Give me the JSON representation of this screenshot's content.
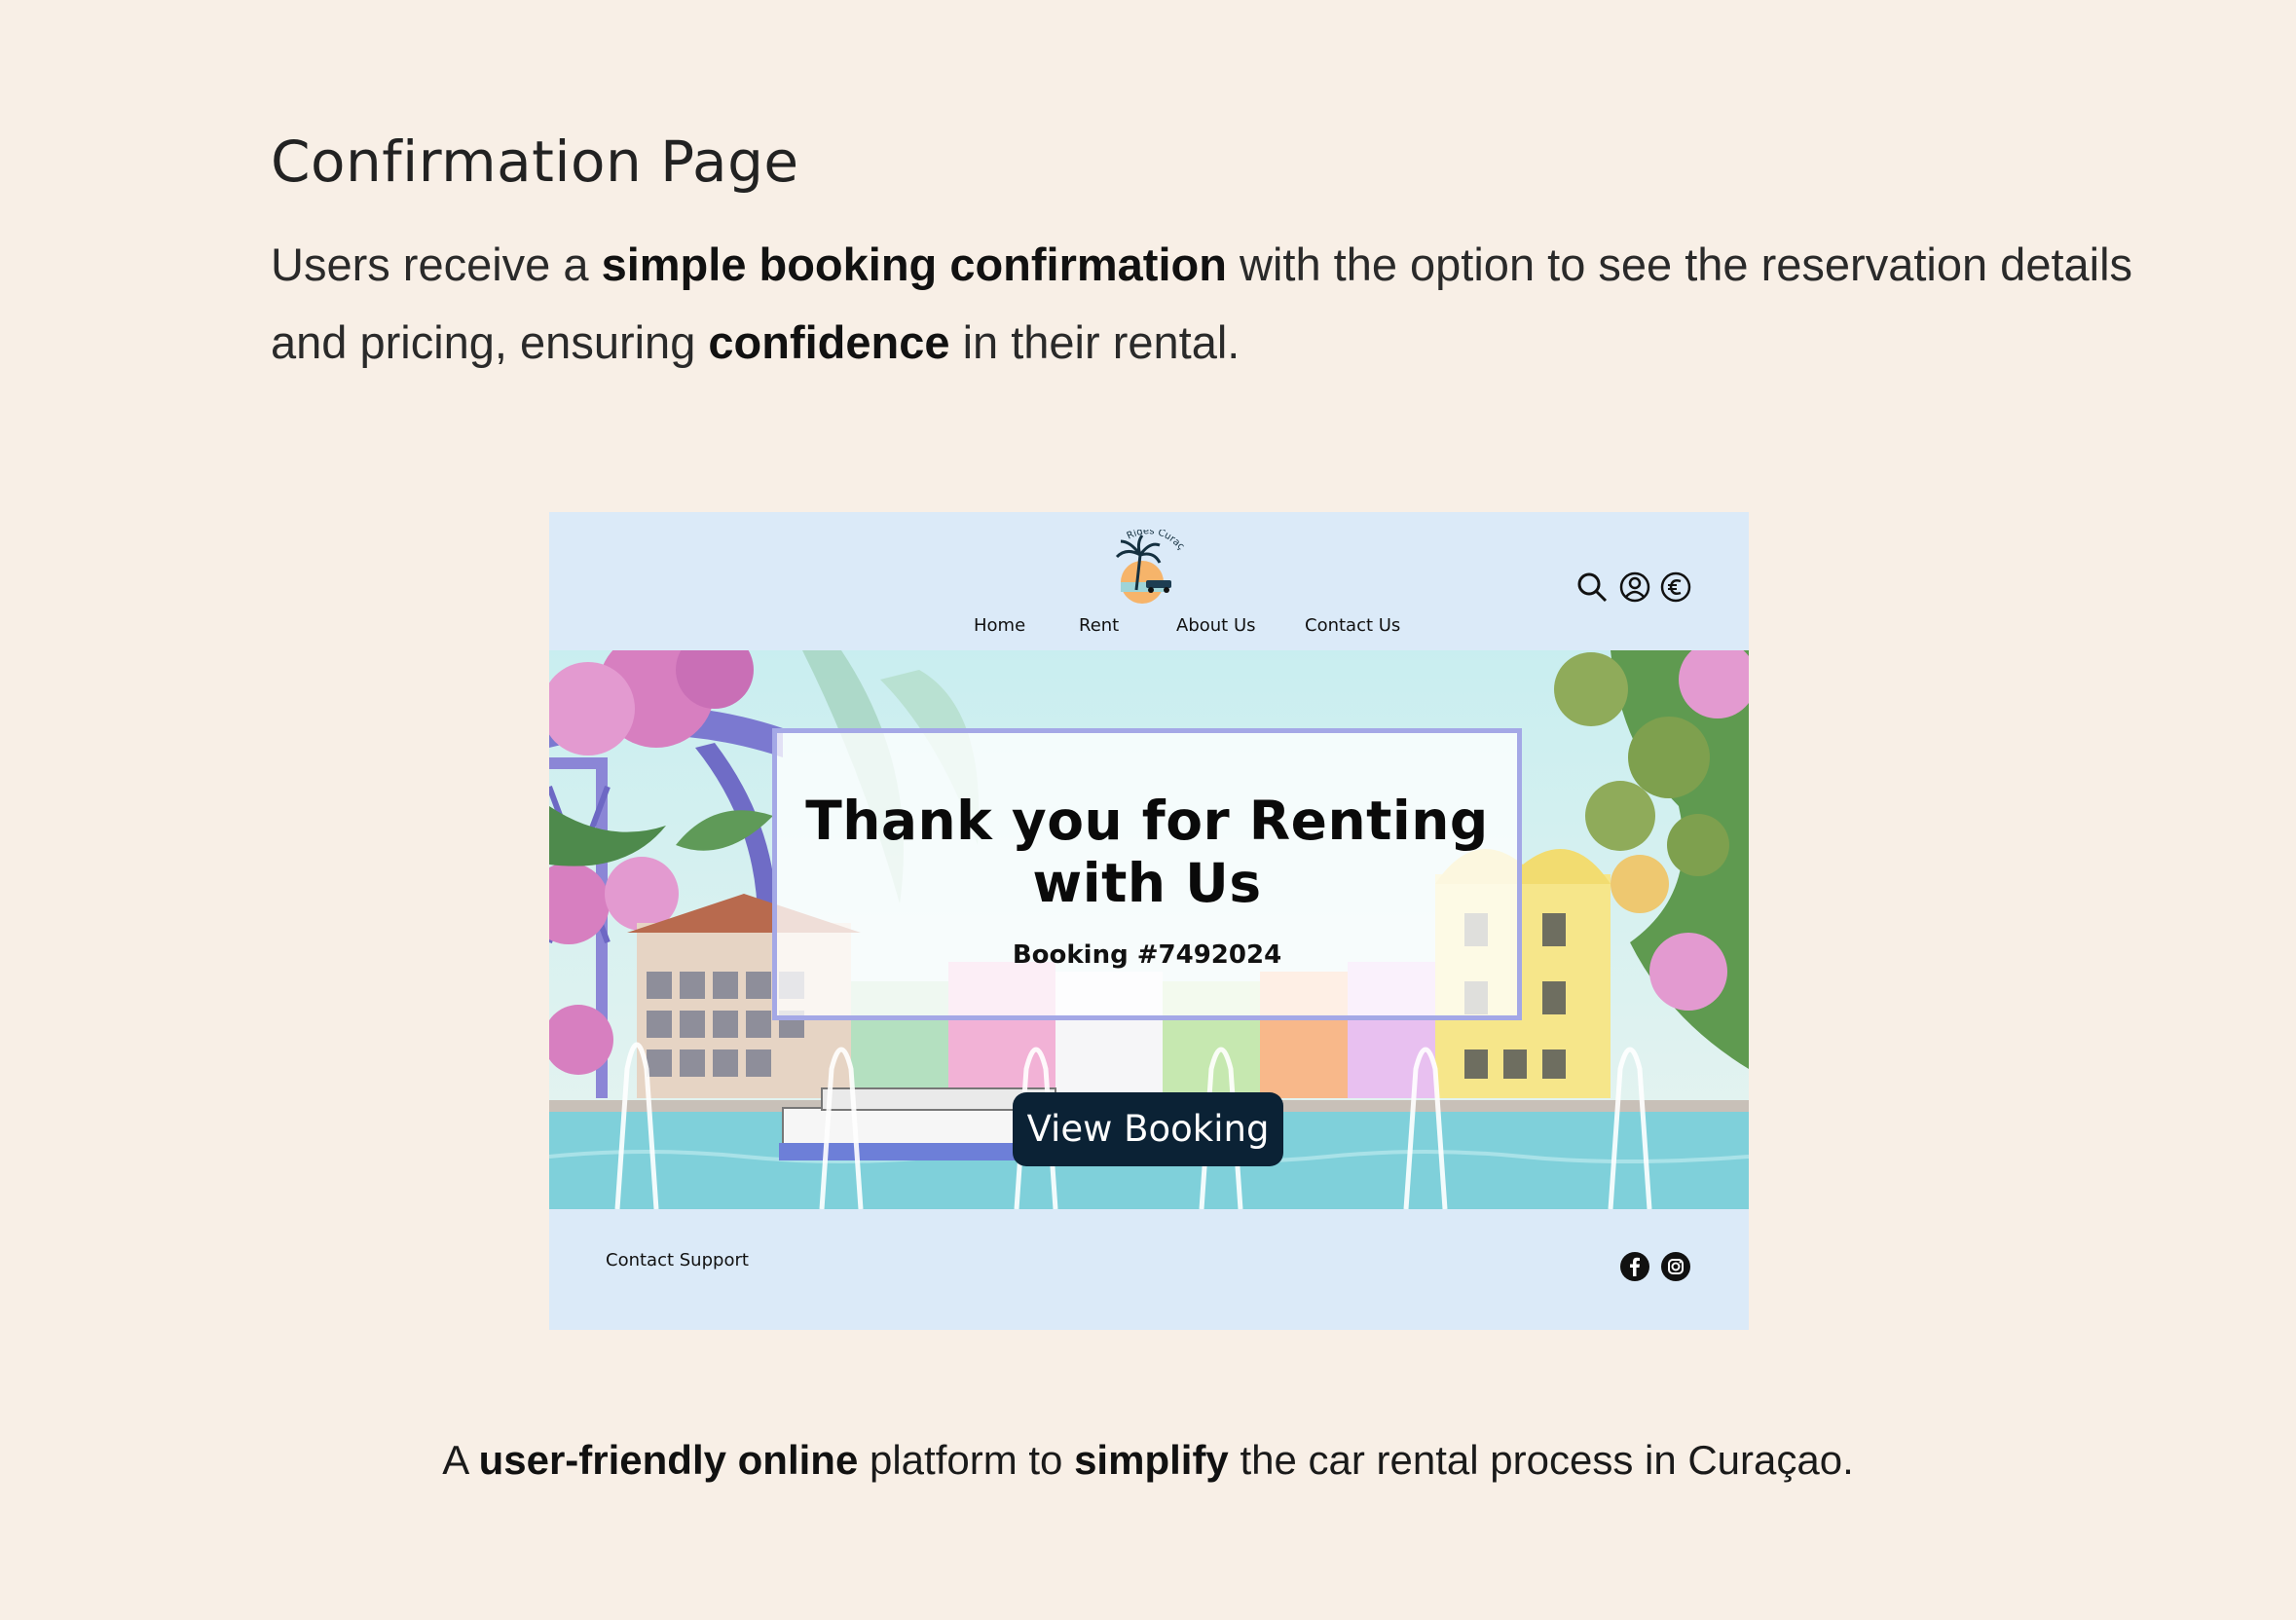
{
  "section": {
    "title": "Confirmation Page",
    "desc_1": "Users receive a ",
    "desc_bold_1": "simple booking confirmation",
    "desc_2": " with the option to see the reservation details and pricing, ensuring ",
    "desc_bold_2": "confidence",
    "desc_3": " in their rental."
  },
  "mockup": {
    "logo": {
      "text": "Rides Curaçao",
      "icon": "palm-tree-car-logo"
    },
    "nav": [
      "Home",
      "Rent",
      "About Us",
      "Contact Us"
    ],
    "header_icons": [
      "search-icon",
      "user-icon",
      "euro-currency-icon"
    ],
    "hero": {
      "title_line1": "Thank you for Renting",
      "title_line2": "with Us",
      "booking": "Booking #7492024",
      "button": "View Booking"
    },
    "footer": {
      "support": "Contact Support",
      "social": [
        "facebook-icon",
        "instagram-icon"
      ]
    },
    "colors": {
      "header_bg": "#dbeaf8",
      "button_bg": "#0b2235",
      "card_border": "#a4a8e6"
    }
  },
  "tagline": {
    "t1": "A ",
    "b1": "user-friendly online",
    "t2": " platform to ",
    "b2": "simplify",
    "t3": " the car rental process in Curaçao."
  }
}
